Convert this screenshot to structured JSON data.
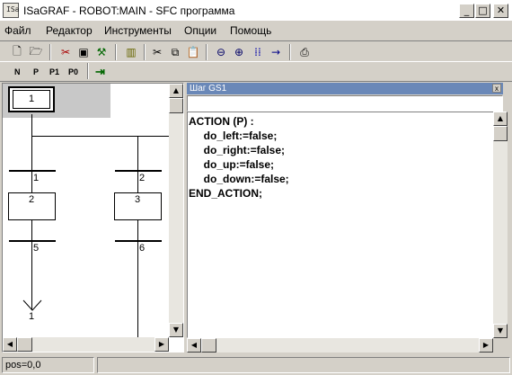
{
  "window": {
    "app_icon_text": "ISa",
    "title": "ISaGRAF - ROBOT:MAIN - SFC программа",
    "minimize_glyph": "_",
    "maximize_glyph": "□",
    "close_glyph": "✕"
  },
  "menu": [
    {
      "label": "Файл"
    },
    {
      "label": "Редактор"
    },
    {
      "label": "Инструменты"
    },
    {
      "label": "Опции"
    },
    {
      "label": "Помощь"
    }
  ],
  "toolbar": [
    {
      "icon": "new-file-icon",
      "glyph": "🗋"
    },
    {
      "icon": "save-icon",
      "glyph": "🗁"
    },
    {
      "icon": "cut-icon",
      "glyph": "✂"
    },
    {
      "icon": "monitor-icon",
      "glyph": "▣"
    },
    {
      "icon": "wrench-icon",
      "glyph": "⚒"
    },
    {
      "icon": "library-icon",
      "glyph": "▥"
    },
    {
      "icon": "scissors-icon",
      "glyph": "✂"
    },
    {
      "icon": "copy-icon",
      "glyph": "⧉"
    },
    {
      "icon": "paste-icon",
      "glyph": "📋"
    },
    {
      "icon": "zoom-out-icon",
      "glyph": "⊖"
    },
    {
      "icon": "zoom-in-icon",
      "glyph": "⊕"
    },
    {
      "icon": "grid-icon",
      "glyph": "⁞⁞"
    },
    {
      "icon": "arrow-right-icon",
      "glyph": "→"
    },
    {
      "icon": "print-icon",
      "glyph": "⎙"
    }
  ],
  "toolbar2": {
    "n": "N",
    "p": "P",
    "p1": "P1",
    "p0": "P0",
    "exit_glyph": "⇥"
  },
  "sfc": {
    "initial_step": "1",
    "steps": [
      "2",
      "3"
    ],
    "transitions": [
      "1",
      "2",
      "5",
      "6"
    ],
    "jump_target": "1"
  },
  "panel": {
    "title": "Шаг GS1",
    "close_glyph": "x",
    "name_value": ""
  },
  "code": [
    "ACTION (P) :",
    "     do_left:=false;",
    "     do_right:=false;",
    "     do_up:=false;",
    "     do_down:=false;",
    "END_ACTION;"
  ],
  "status": {
    "pos": "pos=0,0",
    "message": ""
  }
}
